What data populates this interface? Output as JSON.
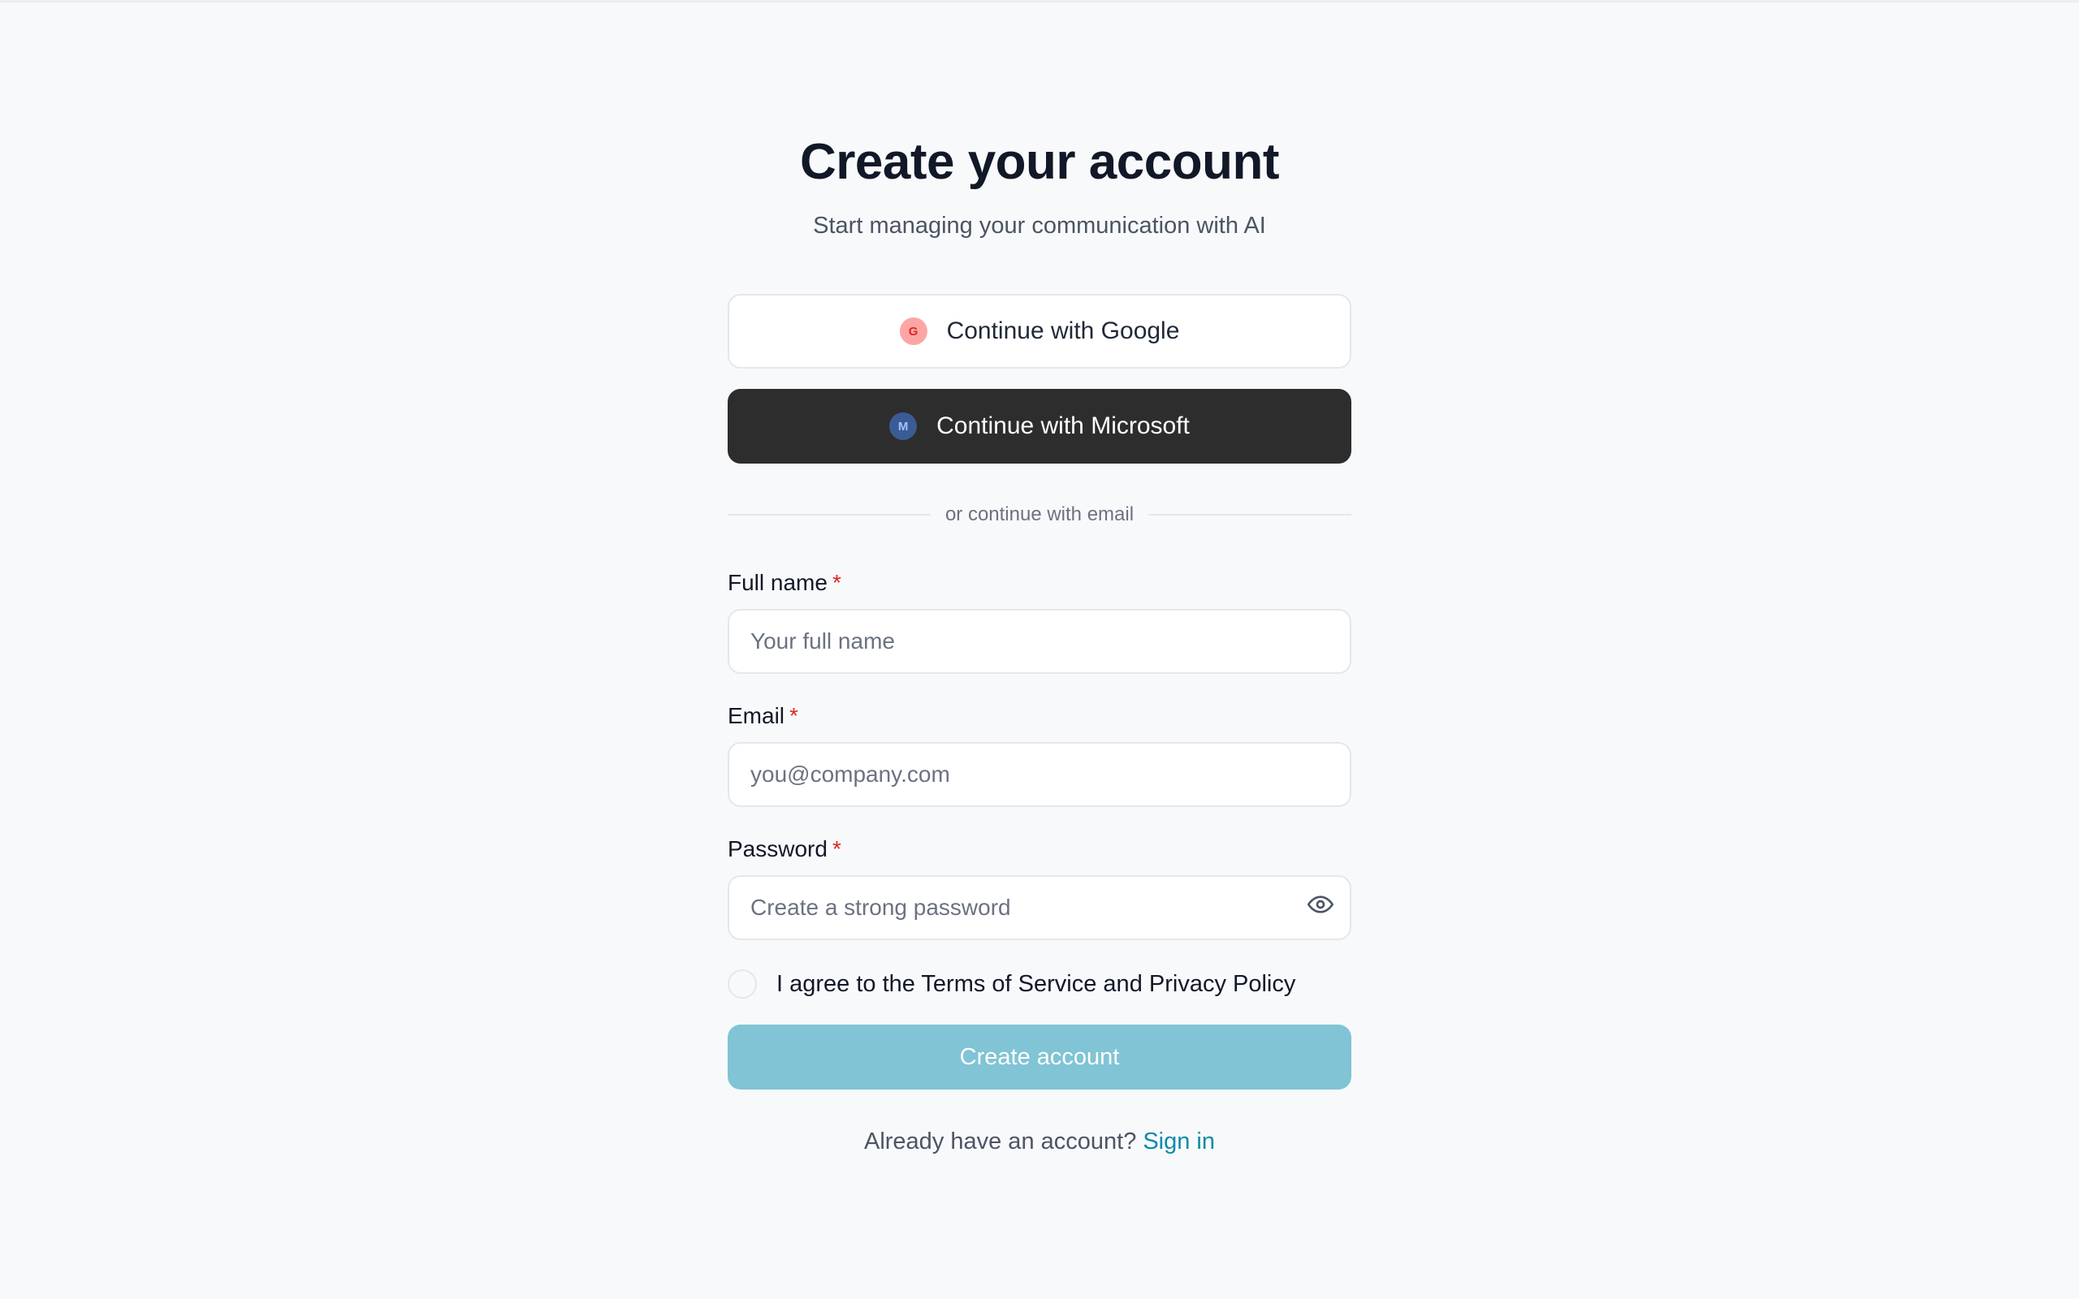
{
  "header": {
    "title": "Create your account",
    "subtitle": "Start managing your communication with AI"
  },
  "oauth": {
    "google": {
      "label": "Continue with Google",
      "icon": "google-icon",
      "icon_glyph": "G",
      "icon_color": "#fca5a5"
    },
    "microsoft": {
      "label": "Continue with Microsoft",
      "icon": "microsoft-icon",
      "icon_glyph": "M",
      "icon_color": "#3b5b95"
    }
  },
  "divider": {
    "text": "or continue with email"
  },
  "form": {
    "full_name": {
      "label": "Full name",
      "required_mark": "*",
      "value": "",
      "placeholder": "Your full name"
    },
    "email": {
      "label": "Email",
      "required_mark": "*",
      "value": "",
      "placeholder": "you@company.com"
    },
    "password": {
      "label": "Password",
      "required_mark": "*",
      "value": "",
      "placeholder": "Create a strong password",
      "toggle_icon": "eye-icon"
    },
    "terms": {
      "label": "I agree to the Terms of Service and Privacy Policy",
      "checked": false
    },
    "submit": {
      "label": "Create account"
    }
  },
  "footer": {
    "prompt": "Already have an account?",
    "link": "Sign in"
  },
  "colors": {
    "background": "#f8f9fb",
    "primary_button": "#80c4d5",
    "microsoft_button": "#2d2d2d",
    "link": "#0e8aa8",
    "required": "#dc2626"
  }
}
